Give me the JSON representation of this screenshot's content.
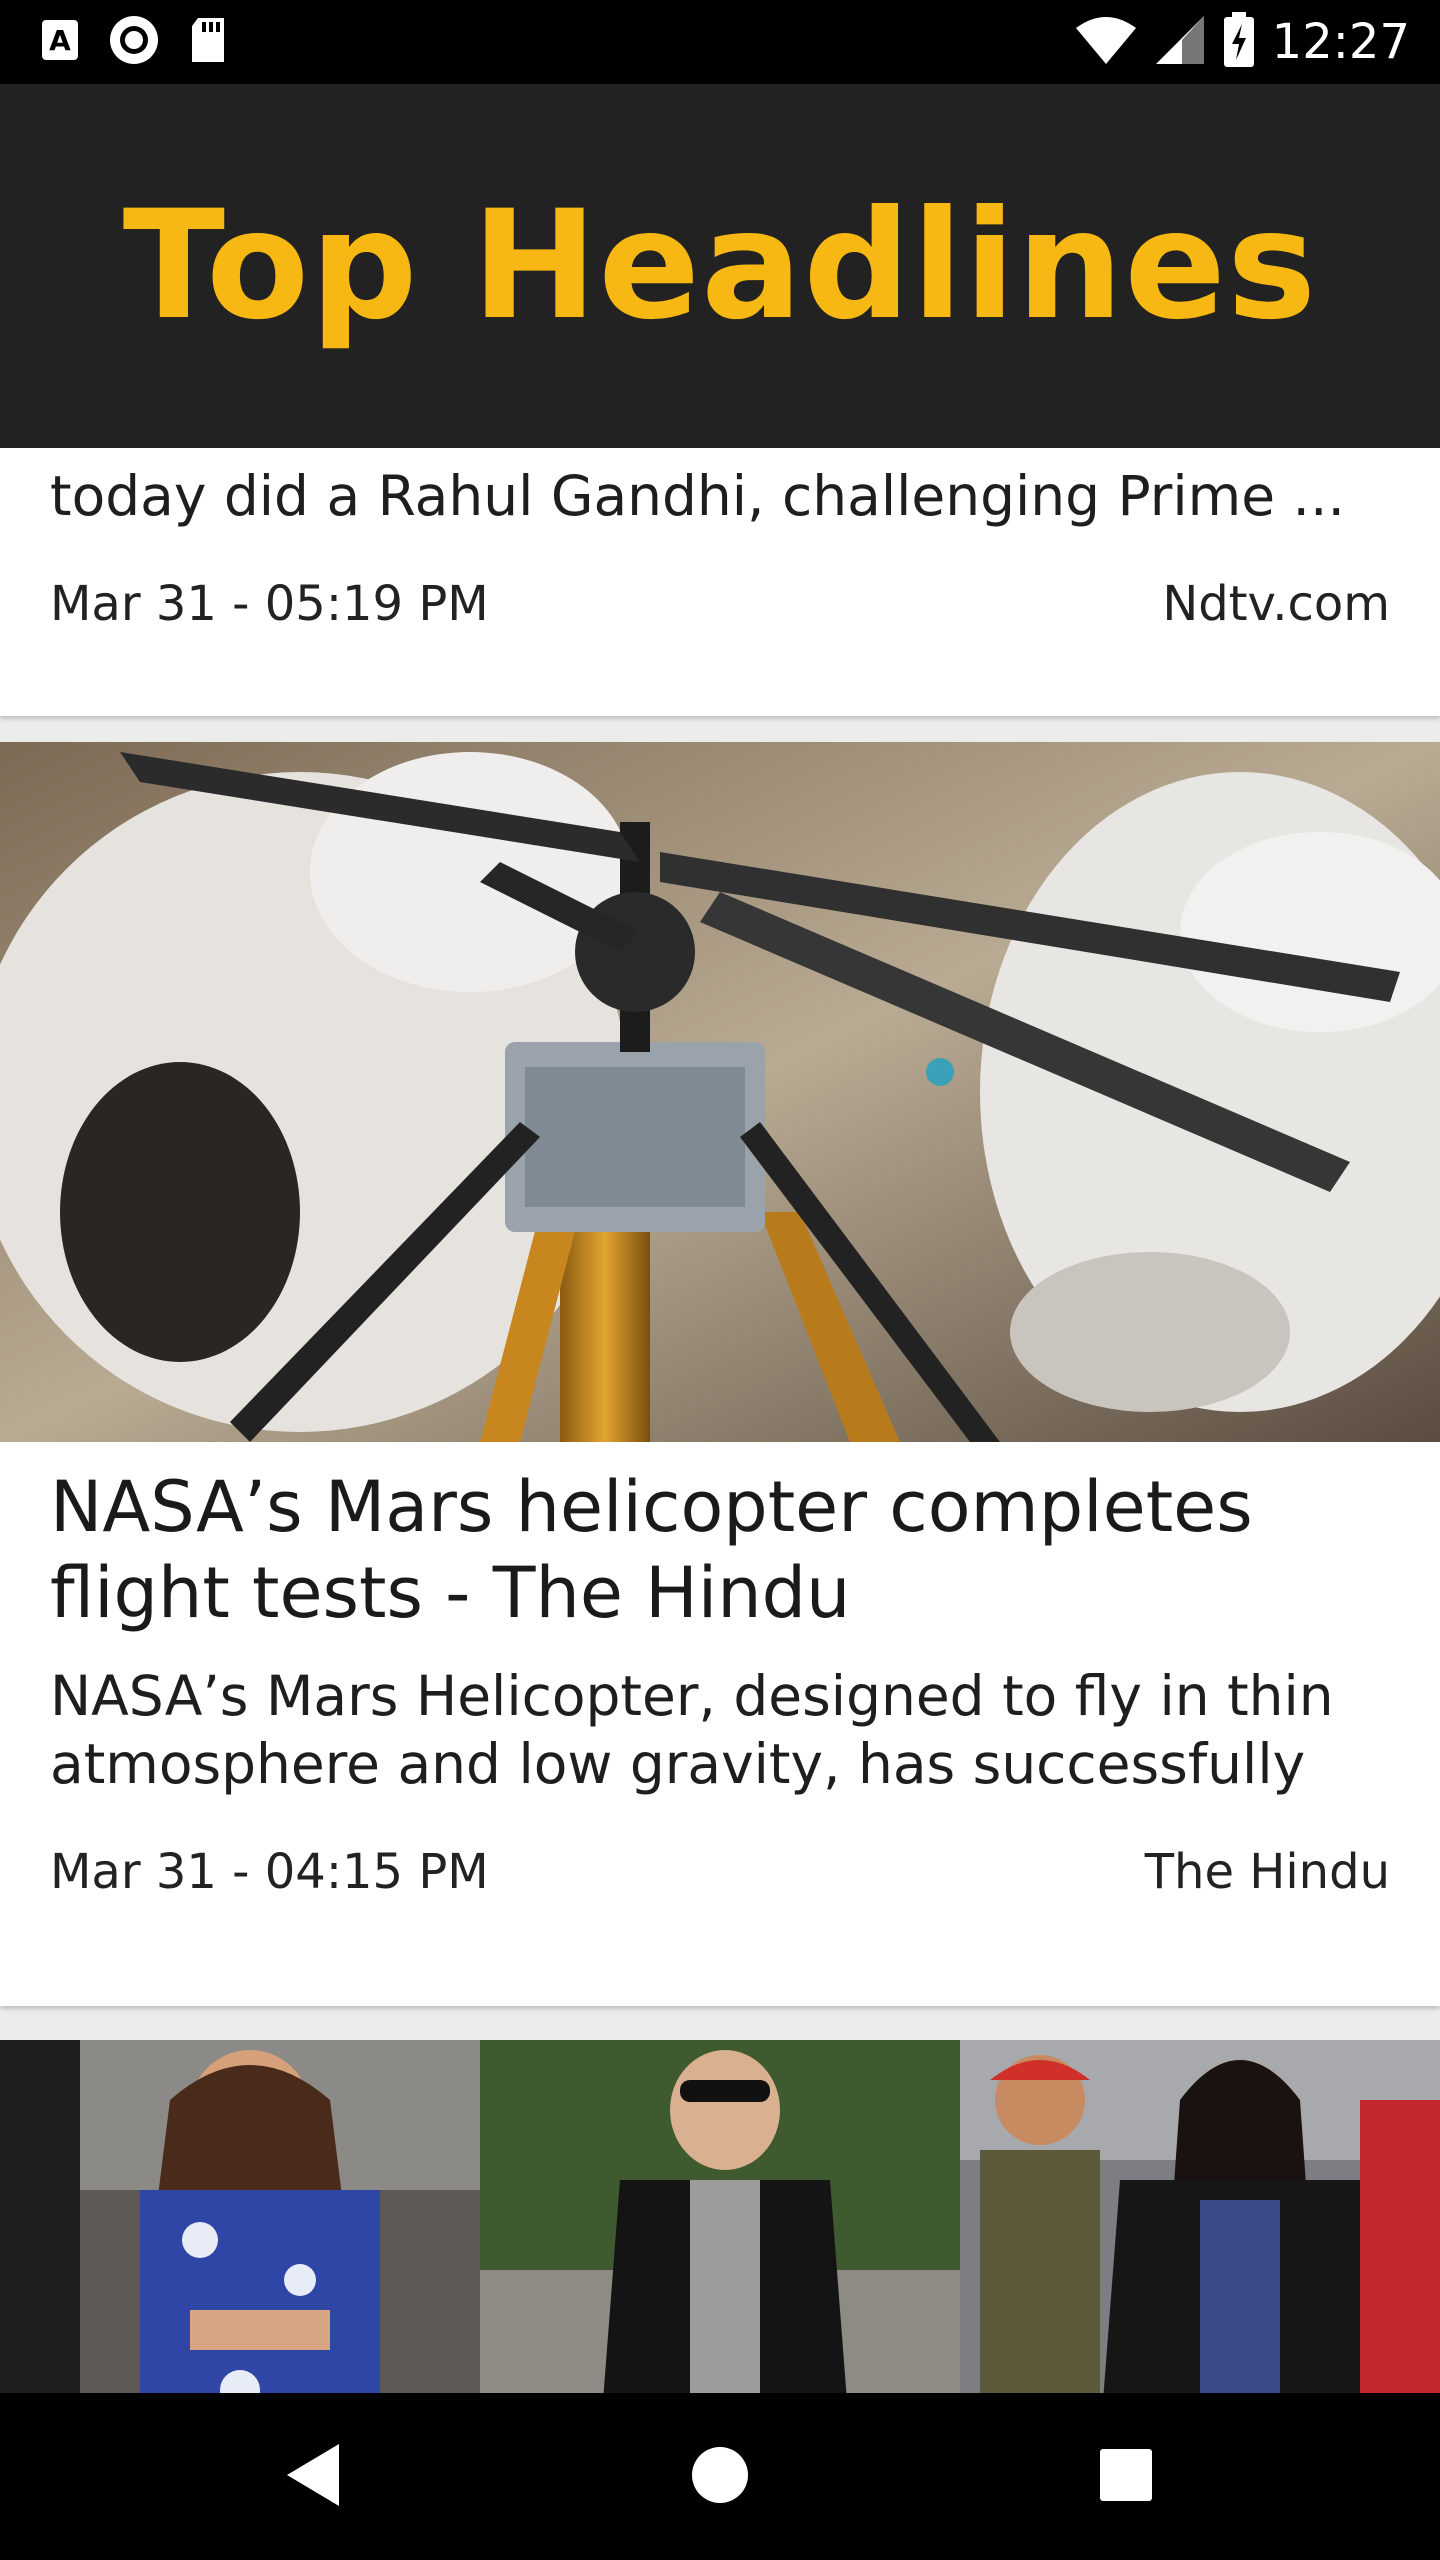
{
  "status_bar": {
    "time": "12:27",
    "left_icons": [
      "a-notification-icon",
      "record-icon",
      "sd-card-icon"
    ],
    "right_icons": [
      "wifi-icon",
      "signal-icon",
      "battery-charging-icon"
    ]
  },
  "app_bar": {
    "title": "Top Headlines",
    "title_color": "#f7b813",
    "background": "#222222"
  },
  "articles": [
    {
      "description": "today did a Rahul Gandhi, challenging Prime ...",
      "date": "Mar 31 - 05:19 PM",
      "source": "Ndtv.com"
    },
    {
      "image": "mars-helicopter-photo",
      "headline": "NASA’s Mars helicopter completes flight tests - The Hindu",
      "description": "NASA’s Mars Helicopter, designed to fly in thin atmosphere and low gravity, has successfully c...",
      "date": "Mar 31 - 04:15 PM",
      "source": "The Hindu"
    },
    {
      "image": "celebrity-airport-photo-collage"
    }
  ],
  "nav_bar": {
    "buttons": [
      "back-icon",
      "home-icon",
      "recents-icon"
    ]
  }
}
